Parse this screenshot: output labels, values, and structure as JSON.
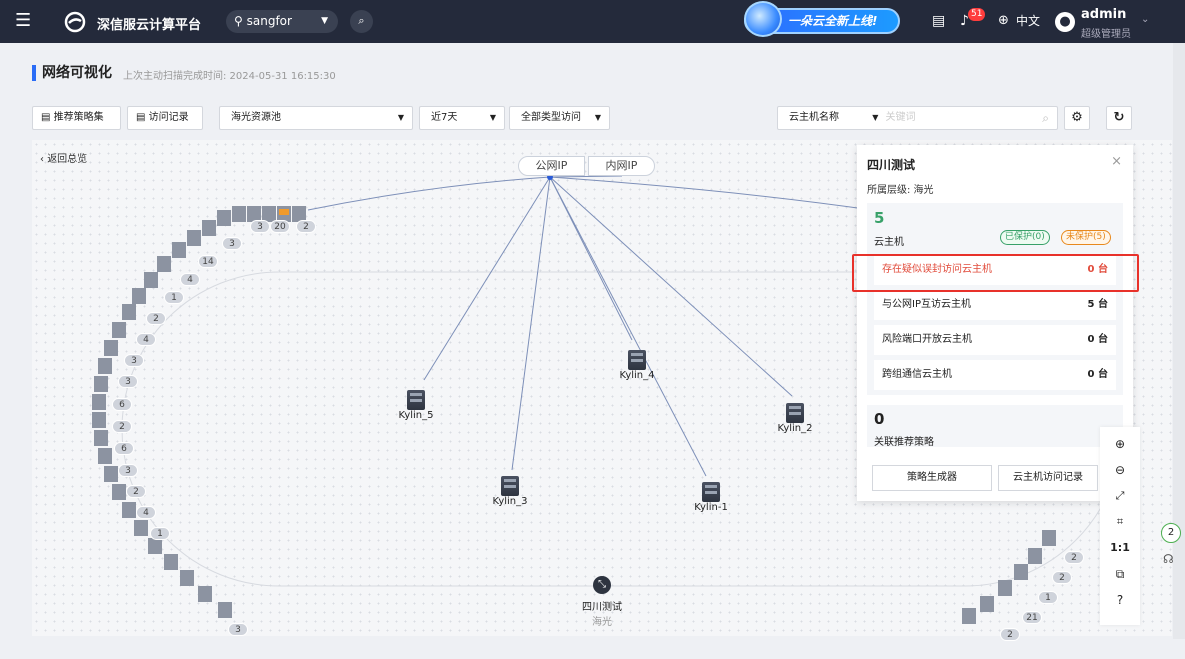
{
  "topbar": {
    "brand": "深信服云计算平台",
    "region": "sangfor",
    "promo": "一朵云全新上线!",
    "notif_count": "51",
    "lang": "中文",
    "user": "admin",
    "role": "超级管理员"
  },
  "page": {
    "title": "网络可视化",
    "subtitle": "上次主动扫描完成时间: 2024-05-31 16:15:30"
  },
  "toolbar": {
    "policy_set": "推荐策略集",
    "access_log": "访问记录",
    "pool": "海光资源池",
    "range": "近7天",
    "access_type": "全部类型访问",
    "search_field": "云主机名称",
    "search_placeholder": "关键词"
  },
  "canvas": {
    "back": "返回总览",
    "public_ip": "公网IP",
    "private_ip": "内网IP",
    "center_name": "四川测试",
    "center_level": "海光"
  },
  "nodes": [
    "Kylin_4",
    "Kylin_5",
    "Kylin_2",
    "Kylin_3",
    "Kylin-1"
  ],
  "counts": {
    "top": [
      "3",
      "20",
      "2"
    ],
    "left": [
      "3",
      "14",
      "4",
      "1",
      "2",
      "4",
      "3",
      "3",
      "6",
      "2",
      "6",
      "3",
      "2",
      "4",
      "1",
      "3"
    ],
    "right": [
      "2",
      "2",
      "1",
      "21",
      "2",
      "2"
    ]
  },
  "panel": {
    "title": "四川测试",
    "level": "所属层级: 海光",
    "vm_count": "5",
    "vm_label": "云主机",
    "protected": "已保护(0)",
    "unprotected": "未保护(5)",
    "rows": [
      {
        "label": "存在疑似误封访问云主机",
        "value": "0 台"
      },
      {
        "label": "与公网IP互访云主机",
        "value": "5 台"
      },
      {
        "label": "风险端口开放云主机",
        "value": "0 台"
      },
      {
        "label": "跨组通信云主机",
        "value": "0 台"
      }
    ],
    "policy_count": "0",
    "policy_label": "关联推荐策略",
    "btn_generator": "策略生成器",
    "btn_vm_log": "云主机访问记录"
  },
  "tools": {
    "one_to_one": "1:1"
  },
  "float_badge": "2"
}
